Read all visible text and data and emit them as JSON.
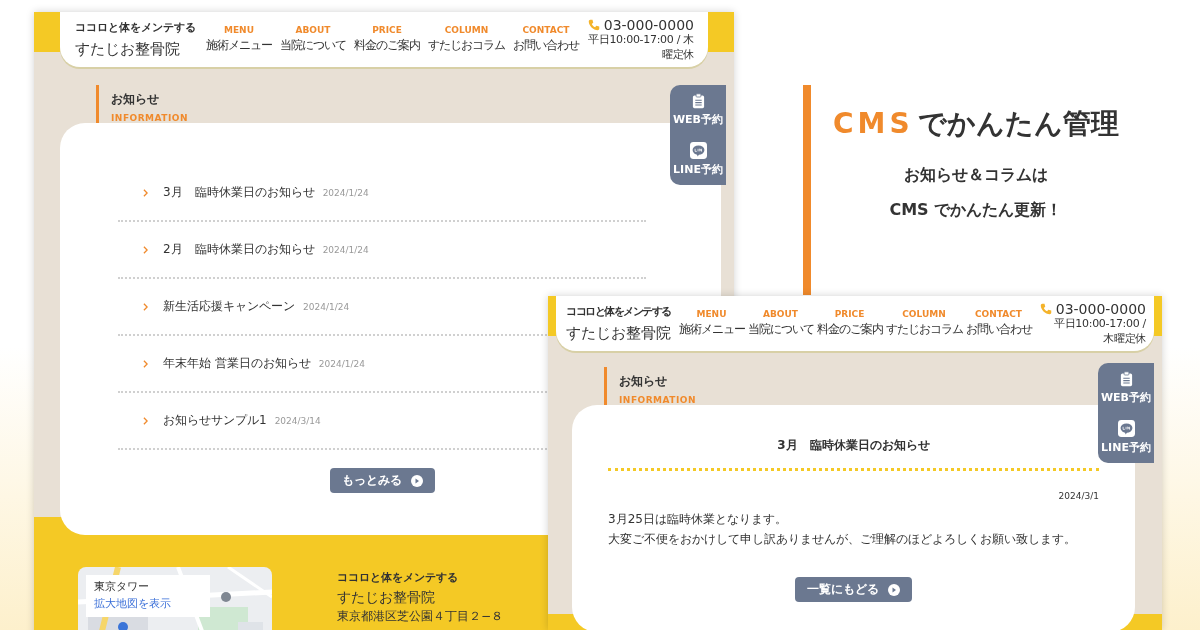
{
  "screens": [
    {
      "kind": "list",
      "header": {
        "tagline": "ココロと体をメンテする",
        "name": "すたじお整骨院",
        "nav": [
          {
            "en": "MENU",
            "ja": "施術メニュー"
          },
          {
            "en": "ABOUT",
            "ja": "当院について"
          },
          {
            "en": "PRICE",
            "ja": "料金のご案内"
          },
          {
            "en": "COLUMN",
            "ja": "すたじおコラム"
          },
          {
            "en": "CONTACT",
            "ja": "お問い合わせ"
          }
        ],
        "phone": "03-000-0000",
        "hours": "平日10:00-17:00 / 木曜定休"
      },
      "section": {
        "title": "お知らせ",
        "subtitle": "INFORMATION"
      },
      "side_buttons": [
        {
          "kind": "web",
          "label": "WEB予約"
        },
        {
          "kind": "line",
          "label": "LINE予約"
        }
      ],
      "items": [
        {
          "title": "3月　臨時休業日のお知らせ",
          "date": "2024/1/24"
        },
        {
          "title": "2月　臨時休業日のお知らせ",
          "date": "2024/1/24"
        },
        {
          "title": "新生活応援キャンペーン",
          "date": "2024/1/24"
        },
        {
          "title": "年末年始 営業日のお知らせ",
          "date": "2024/1/24"
        },
        {
          "title": "お知らせサンプル1",
          "date": "2024/3/14"
        }
      ],
      "more_button": "もっとみる",
      "footer": {
        "map_place": "東京タワー",
        "map_link": "拡大地図を表示",
        "tagline": "ココロと体をメンテする",
        "name": "すたじお整骨院",
        "address": "東京都港区芝公園４丁目２−８"
      }
    },
    {
      "kind": "detail",
      "header": {
        "tagline": "ココロと体をメンテする",
        "name": "すたじお整骨院",
        "nav": [
          {
            "en": "MENU",
            "ja": "施術メニュー"
          },
          {
            "en": "ABOUT",
            "ja": "当院について"
          },
          {
            "en": "PRICE",
            "ja": "料金のご案内"
          },
          {
            "en": "COLUMN",
            "ja": "すたじおコラム"
          },
          {
            "en": "CONTACT",
            "ja": "お問い合わせ"
          }
        ],
        "phone": "03-000-0000",
        "hours": "平日10:00-17:00 / 木曜定休"
      },
      "section": {
        "title": "お知らせ",
        "subtitle": "INFORMATION"
      },
      "side_buttons": [
        {
          "kind": "web",
          "label": "WEB予約"
        },
        {
          "kind": "line",
          "label": "LINE予約"
        }
      ],
      "article": {
        "title": "3月　臨時休業日のお知らせ",
        "date": "2024/3/1",
        "body": [
          "3月25日は臨時休業となります。",
          "大変ご不便をおかけして申し訳ありませんが、ご理解のほどよろしくお願い致します。"
        ],
        "back_button": "一覧にもどる"
      }
    }
  ],
  "promo": {
    "title_accent": "CMS",
    "title_rest": "でかんたん管理",
    "lines": [
      "お知らせ＆コラムは",
      "CMS でかんたん更新！"
    ]
  }
}
